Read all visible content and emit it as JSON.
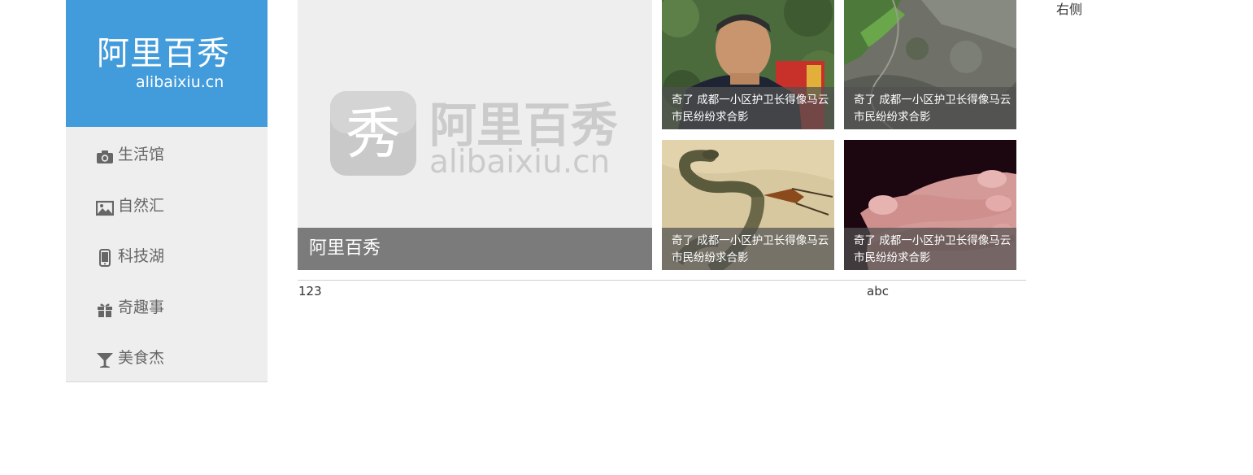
{
  "logo": {
    "cn": "阿里百秀",
    "en": "alibaixiu.cn"
  },
  "nav": {
    "items": [
      {
        "label": "生活馆",
        "icon": "camera-icon"
      },
      {
        "label": "自然汇",
        "icon": "picture-icon"
      },
      {
        "label": "科技湖",
        "icon": "phone-icon"
      },
      {
        "label": "奇趣事",
        "icon": "gift-icon"
      },
      {
        "label": "美食杰",
        "icon": "cocktail-glass-icon"
      }
    ]
  },
  "hero": {
    "caption": "阿里百秀",
    "logo_cn": "阿里百秀",
    "logo_en": "alibaixiu.cn",
    "logo_glyph": "秀"
  },
  "thumbs": [
    {
      "caption": "奇了 成都一小区护卫长得像马云 市民纷纷求合影",
      "image": "portrait-photo"
    },
    {
      "caption": "奇了 成都一小区护卫长得像马云 市民纷纷求合影",
      "image": "aerial-landscape-photo"
    },
    {
      "caption": "奇了 成都一小区护卫长得像马云 市民纷纷求合影",
      "image": "snake-photo"
    },
    {
      "caption": "奇了 成都一小区护卫长得像马云 市民纷纷求合影",
      "image": "fingers-photo"
    }
  ],
  "footer": {
    "left": "123",
    "right": "abc"
  },
  "right_column": {
    "label": "右侧"
  },
  "colors": {
    "brand": "#429bdb",
    "sidebar_bg": "#eeeeee",
    "caption_bg": "#7b7b7b"
  }
}
